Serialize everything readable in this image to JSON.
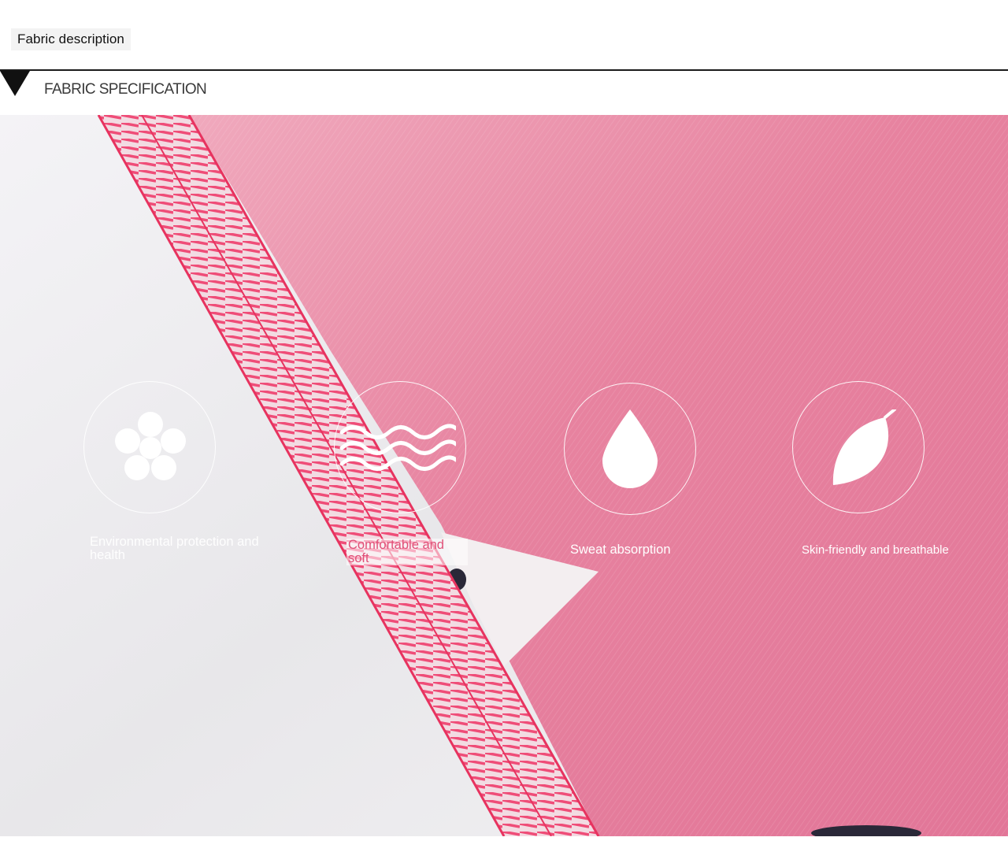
{
  "header": {
    "title": "Fabric description",
    "section": "FABRIC SPECIFICATION"
  },
  "features": [
    {
      "label": "Environmental protection and health",
      "icon": "flower-icon"
    },
    {
      "label": "Comfortable and soft",
      "icon": "waves-icon"
    },
    {
      "label": "Sweat absorption",
      "icon": "water-drop-icon"
    },
    {
      "label": "Skin-friendly and breathable",
      "icon": "leaf-icon"
    }
  ],
  "colors": {
    "pink_fabric": "#e7829f",
    "white_fabric": "#ecebee",
    "stitch": "#ee3465",
    "rule": "#1a1a1a"
  }
}
